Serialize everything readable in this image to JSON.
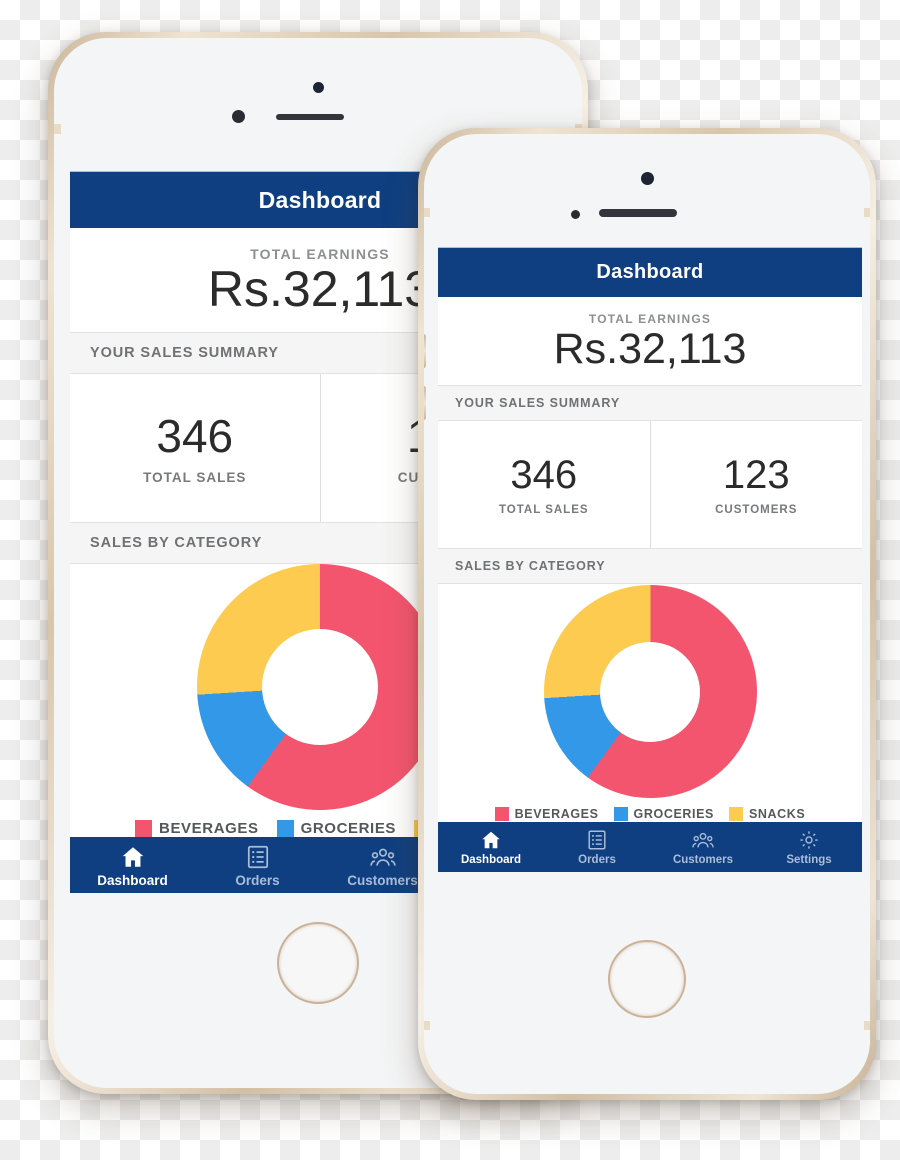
{
  "app": {
    "title": "Dashboard",
    "earnings_label": "TOTAL EARNINGS",
    "earnings_value": "Rs.32,113",
    "summary_section_title": "YOUR SALES SUMMARY",
    "category_section_title": "SALES BY CATEGORY",
    "stats": [
      {
        "value": "346",
        "caption": "TOTAL SALES"
      },
      {
        "value": "123",
        "caption": "CUSTOMERS"
      }
    ],
    "tabs": [
      {
        "label": "Dashboard",
        "icon": "home-icon",
        "active": true
      },
      {
        "label": "Orders",
        "icon": "list-icon",
        "active": false
      },
      {
        "label": "Customers",
        "icon": "people-icon",
        "active": false
      },
      {
        "label": "Settings",
        "icon": "gear-icon",
        "active": false
      }
    ]
  },
  "chart_data": {
    "type": "pie",
    "title": "SALES BY CATEGORY",
    "donut": true,
    "legend_position": "bottom",
    "categories": [
      "BEVERAGES",
      "GROCERIES",
      "SNACKS"
    ],
    "values": [
      60,
      14,
      26
    ],
    "unit": "percent",
    "colors": [
      "#F4556E",
      "#3498E8",
      "#FCCB4F"
    ],
    "start_angle_deg": 0,
    "direction": "clockwise"
  },
  "theme": {
    "navy": "#0F3F80",
    "pink": "#F4556E",
    "blue": "#3498E8",
    "yellow": "#FCCB4F",
    "section_bg": "#F5F5F5",
    "bezel_gold": "#D8C6AB"
  }
}
